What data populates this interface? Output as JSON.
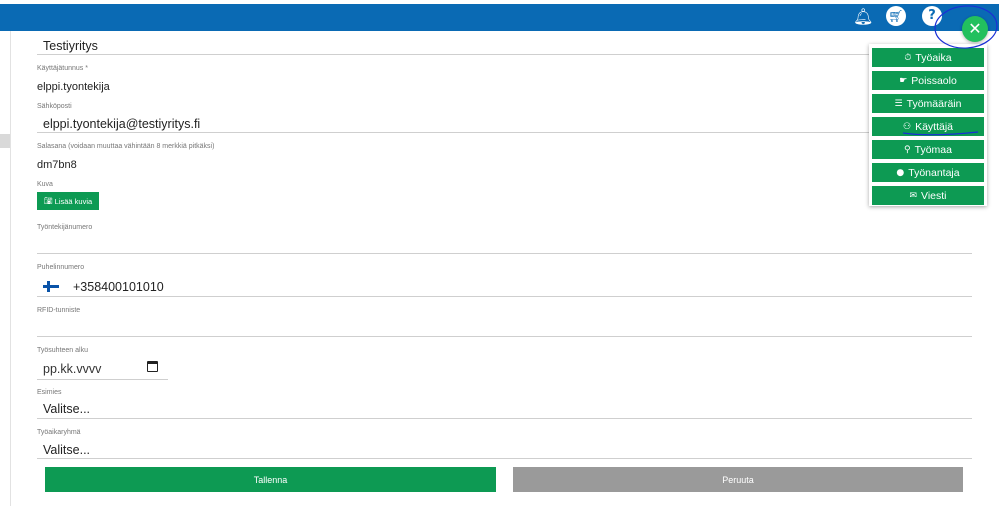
{
  "header": {
    "icons": [
      "bell-icon",
      "cart-icon",
      "help-icon"
    ]
  },
  "form": {
    "company_value": "Testiyritys",
    "username": {
      "label": "Käyttäjätunnus *",
      "value": "elppi.tyontekija"
    },
    "email": {
      "label": "Sähköposti",
      "value": "elppi.tyontekija@testiyritys.fi"
    },
    "password": {
      "label": "Salasana (voidaan muuttaa vähintään 8 merkkiä pitkäksi)",
      "value": "dm7bn8"
    },
    "photo": {
      "label": "Kuva",
      "button": "Lisää kuvia"
    },
    "employee_number": {
      "label": "Työntekijänumero",
      "value": ""
    },
    "phone": {
      "label": "Puhelinnumero",
      "value": "+358400101010"
    },
    "rfid": {
      "label": "RFID-tunniste",
      "value": ""
    },
    "start_date": {
      "label": "Työsuhteen alku",
      "placeholder": "pp.kk.vvvv"
    },
    "supervisor": {
      "label": "Esimies",
      "value": "Valitse..."
    },
    "work_time_group": {
      "label": "Työaikaryhmä",
      "value": "Valitse..."
    }
  },
  "actions": {
    "save": "Tallenna",
    "cancel": "Peruuta"
  },
  "fab_menu": {
    "close_icon": "close-icon",
    "items": [
      {
        "label": "Työaika",
        "icon": "stopwatch-icon",
        "glyph": "⏱"
      },
      {
        "label": "Poissaolo",
        "icon": "thumb-icon",
        "glyph": "☛"
      },
      {
        "label": "Työmääräin",
        "icon": "list-icon",
        "glyph": "☰"
      },
      {
        "label": "Käyttäjä",
        "icon": "users-icon",
        "glyph": "⚇"
      },
      {
        "label": "Työmaa",
        "icon": "site-icon",
        "glyph": "⚲"
      },
      {
        "label": "Työnantaja",
        "icon": "person-icon",
        "glyph": "●"
      },
      {
        "label": "Viesti",
        "icon": "envelope-icon",
        "glyph": "✉"
      }
    ]
  },
  "colors": {
    "header": "#0a6ab4",
    "primary": "#0d9a53",
    "secondary": "#9a9a9a",
    "fab": "#22c05e"
  }
}
